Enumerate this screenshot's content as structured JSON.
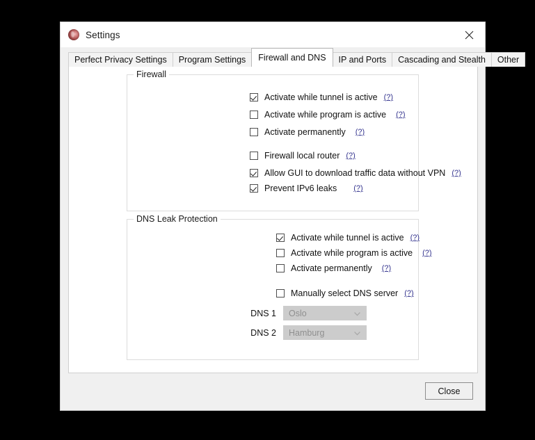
{
  "window": {
    "title": "Settings",
    "icon": "app-logo-icon",
    "close_icon": "close-icon"
  },
  "tabs": [
    {
      "label": "Perfect Privacy Settings",
      "active": false
    },
    {
      "label": "Program Settings",
      "active": false
    },
    {
      "label": "Firewall and DNS",
      "active": true
    },
    {
      "label": "IP and Ports",
      "active": false
    },
    {
      "label": "Cascading and Stealth",
      "active": false
    },
    {
      "label": "Other",
      "active": false
    }
  ],
  "firewall": {
    "group_title": "Firewall",
    "options": [
      {
        "label": "Activate while tunnel is active",
        "checked": true,
        "help": "(?)"
      },
      {
        "label": "Activate while program is active",
        "checked": false,
        "help": "(?)"
      },
      {
        "label": "Activate permanently",
        "checked": false,
        "help": "(?)"
      },
      {
        "label": "Firewall local router",
        "checked": false,
        "help": "(?)"
      },
      {
        "label": "Allow GUI to download traffic data without VPN",
        "checked": true,
        "help": "(?)"
      },
      {
        "label": "Prevent IPv6 leaks",
        "checked": true,
        "help": "(?)"
      }
    ]
  },
  "dns": {
    "group_title": "DNS Leak Protection",
    "options": [
      {
        "label": "Activate while tunnel is active",
        "checked": true,
        "help": "(?)"
      },
      {
        "label": "Activate while program is active",
        "checked": false,
        "help": "(?)"
      },
      {
        "label": "Activate permanently",
        "checked": false,
        "help": "(?)"
      },
      {
        "label": "Manually select DNS server",
        "checked": false,
        "help": "(?)"
      }
    ],
    "servers": [
      {
        "label": "DNS 1",
        "value": "Oslo",
        "enabled": false
      },
      {
        "label": "DNS 2",
        "value": "Hamburg",
        "enabled": false
      }
    ]
  },
  "footer": {
    "close_label": "Close"
  },
  "colors": {
    "window_bg": "#f0f0f0",
    "content_bg": "#ffffff",
    "help_link": "#35358f",
    "disabled_combo": "#cccccc",
    "page_bg": "#000000"
  }
}
